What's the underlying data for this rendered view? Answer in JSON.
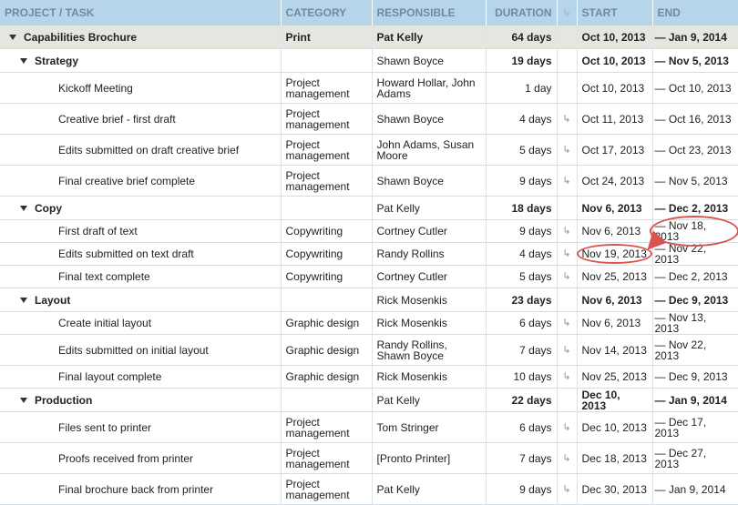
{
  "headers": {
    "task": "PROJECT / TASK",
    "category": "CATEGORY",
    "responsible": "RESPONSIBLE",
    "duration": "DURATION",
    "dependency": "↳",
    "start": "START",
    "end": "END"
  },
  "rows": [
    {
      "task": "Capabilities Brochure",
      "category": "Print",
      "responsible": "Pat Kelly",
      "duration": "64 days",
      "dep": "",
      "start": "Oct 10, 2013",
      "end": "— Jan 9, 2014"
    },
    {
      "task": "Strategy",
      "category": "",
      "responsible": "Shawn Boyce",
      "duration": "19 days",
      "dep": "",
      "start": "Oct 10, 2013",
      "end": "— Nov 5, 2013"
    },
    {
      "task": "Kickoff Meeting",
      "category": "Project management",
      "responsible": "Howard Hollar, John Adams",
      "duration": "1 day",
      "dep": "",
      "start": "Oct 10, 2013",
      "end": "— Oct 10, 2013"
    },
    {
      "task": "Creative brief - first draft",
      "category": "Project management",
      "responsible": "Shawn Boyce",
      "duration": "4 days",
      "dep": "↳",
      "start": "Oct 11, 2013",
      "end": "— Oct 16, 2013"
    },
    {
      "task": "Edits submitted on draft creative brief",
      "category": "Project management",
      "responsible": "John Adams, Susan Moore",
      "duration": "5 days",
      "dep": "↳",
      "start": "Oct 17, 2013",
      "end": "— Oct 23, 2013"
    },
    {
      "task": "Final creative brief complete",
      "category": "Project management",
      "responsible": "Shawn Boyce",
      "duration": "9 days",
      "dep": "↳",
      "start": "Oct 24, 2013",
      "end": "— Nov 5, 2013"
    },
    {
      "task": "Copy",
      "category": "",
      "responsible": "Pat Kelly",
      "duration": "18 days",
      "dep": "",
      "start": "Nov 6, 2013",
      "end": "— Dec 2, 2013"
    },
    {
      "task": "First draft of text",
      "category": "Copywriting",
      "responsible": "Cortney Cutler",
      "duration": "9 days",
      "dep": "↳",
      "start": "Nov 6, 2013",
      "end": "— Nov 18, 2013"
    },
    {
      "task": "Edits submitted on text draft",
      "category": "Copywriting",
      "responsible": "Randy Rollins",
      "duration": "4 days",
      "dep": "↳",
      "start": "Nov 19, 2013",
      "end": "— Nov 22, 2013"
    },
    {
      "task": "Final text complete",
      "category": "Copywriting",
      "responsible": "Cortney Cutler",
      "duration": "5 days",
      "dep": "↳",
      "start": "Nov 25, 2013",
      "end": "— Dec 2, 2013"
    },
    {
      "task": "Layout",
      "category": "",
      "responsible": "Rick Mosenkis",
      "duration": "23 days",
      "dep": "",
      "start": "Nov 6, 2013",
      "end": "— Dec 9, 2013"
    },
    {
      "task": "Create initial layout",
      "category": "Graphic design",
      "responsible": "Rick Mosenkis",
      "duration": "6 days",
      "dep": "↳",
      "start": "Nov 6, 2013",
      "end": "— Nov 13, 2013"
    },
    {
      "task": "Edits submitted on initial layout",
      "category": "Graphic design",
      "responsible": "Randy Rollins, Shawn Boyce",
      "duration": "7 days",
      "dep": "↳",
      "start": "Nov 14, 2013",
      "end": "— Nov 22, 2013"
    },
    {
      "task": "Final layout complete",
      "category": "Graphic design",
      "responsible": "Rick Mosenkis",
      "duration": "10 days",
      "dep": "↳",
      "start": "Nov 25, 2013",
      "end": "— Dec 9, 2013"
    },
    {
      "task": "Production",
      "category": "",
      "responsible": "Pat Kelly",
      "duration": "22 days",
      "dep": "",
      "start": "Dec 10, 2013",
      "end": "— Jan 9, 2014"
    },
    {
      "task": "Files sent to printer",
      "category": "Project management",
      "responsible": "Tom Stringer",
      "duration": "6 days",
      "dep": "↳",
      "start": "Dec 10, 2013",
      "end": "— Dec 17, 2013"
    },
    {
      "task": "Proofs received from printer",
      "category": "Project management",
      "responsible": "[Pronto Printer]",
      "duration": "7 days",
      "dep": "↳",
      "start": "Dec 18, 2013",
      "end": "— Dec 27, 2013"
    },
    {
      "task": "Final brochure back from printer",
      "category": "Project management",
      "responsible": "Pat Kelly",
      "duration": "9 days",
      "dep": "↳",
      "start": "Dec 30, 2013",
      "end": "— Jan 9, 2014"
    }
  ],
  "annotation_color": "#d9534f"
}
